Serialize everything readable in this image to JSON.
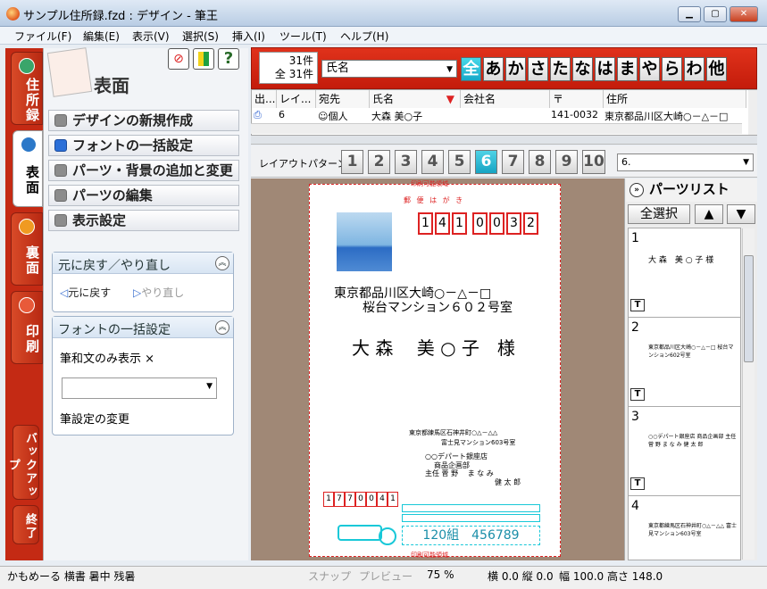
{
  "window": {
    "title": "サンプル住所録.fzd : デザイン - 筆王",
    "min": "▁",
    "max": "▢",
    "close": "✕"
  },
  "menu": [
    "ファイル(F)",
    "編集(E)",
    "表示(V)",
    "選択(S)",
    "挿入(I)",
    "ツール(T)",
    "ヘルプ(H)"
  ],
  "vtabs": {
    "address": "住所録",
    "front": "表面",
    "back": "裏面",
    "print": "印刷",
    "backup": "バックアップ",
    "exit": "終了"
  },
  "nav": {
    "title": "表面",
    "items": [
      "デザインの新規作成",
      "フォントの一括設定",
      "パーツ・背景の追加と変更",
      "パーツの編集",
      "表示設定"
    ],
    "selected_index": 1
  },
  "undo_group": {
    "title": "元に戻す／やり直し",
    "undo": "元に戻す",
    "redo": "やり直し"
  },
  "font_group": {
    "title": "フォントの一括設定",
    "japanese_only": "和文のみ表示 ×",
    "change": "設定の変更"
  },
  "records": {
    "count1": "31件",
    "count2": "全 31件",
    "field": "氏名"
  },
  "kana": [
    "全",
    "あ",
    "か",
    "さ",
    "た",
    "な",
    "は",
    "ま",
    "や",
    "ら",
    "わ",
    "他"
  ],
  "grid": {
    "headers": [
      "出...",
      "レイ...",
      "宛先",
      "氏名",
      "会社名",
      "〒",
      "住所"
    ],
    "row": [
      "6",
      "個人",
      "大森 美○子",
      "",
      "141-0032",
      "東京都品川区大崎○－△－□"
    ]
  },
  "layout": {
    "label": "レイアウトパターン",
    "nums": [
      "1",
      "2",
      "3",
      "4",
      "5",
      "6",
      "7",
      "8",
      "9",
      "10"
    ],
    "selected": "6",
    "select_value": "6."
  },
  "card": {
    "top_note": "印刷可能領域",
    "postal_label": "郵 便 は が き",
    "zip": [
      "1",
      "4",
      "1",
      "0",
      "0",
      "3",
      "2"
    ],
    "address1": "東京都品川区大崎○－△－□",
    "address2": "桜台マンション６０２号室",
    "name": "大 森　 美 ○ 子　様",
    "sender_addr1": "東京都練馬区石神井町○△－△△",
    "sender_addr2": "富士見マンション603号室",
    "sender_company": "○○デパート銀座店",
    "sender_dept": "商品企画部",
    "sender_title": "主任 菅 野　 ま な み",
    "sender_name2": "健 太 郎",
    "sender_zip": [
      "1",
      "7",
      "7",
      "0",
      "0",
      "4",
      "1"
    ],
    "barcode_text": "120組　456789",
    "bottom_note": "印刷可能領域"
  },
  "parts": {
    "title": "パーツリスト",
    "select_all": "全選択",
    "up": "▲",
    "down": "▼",
    "items": [
      {
        "num": "1",
        "text": "大 森　美 ○ 子 様"
      },
      {
        "num": "2",
        "text": "東京都品川区大崎○－△－□ 桜台マンション602号室"
      },
      {
        "num": "3",
        "text": "○○デパート銀座店 商品企画部 主任 菅 野 ま な み 健 太 郎"
      },
      {
        "num": "4",
        "text": "東京都練馬区石神井町○△－△△ 富士見マンション603号室"
      }
    ],
    "t_icon": "T"
  },
  "status": {
    "left": "かもめーる 横書 暑中 残暑",
    "snap": "スナップ",
    "preview": "プレビュー",
    "zoom": "75 %",
    "pos": "横 0.0 縦 0.0",
    "size": "幅 100.0 高さ 148.0"
  },
  "colors": {
    "accent_red": "#d0250f",
    "cyan": "#18a8c8"
  }
}
